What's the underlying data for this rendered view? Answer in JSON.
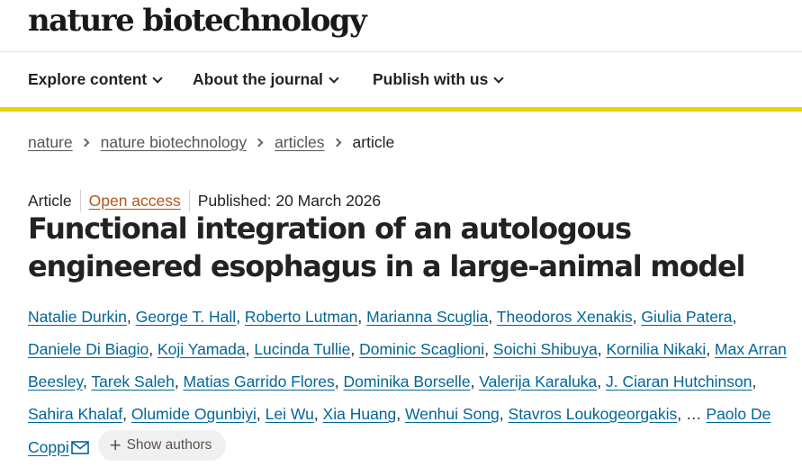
{
  "colors": {
    "accent": "#e6d40a",
    "link": "#006699",
    "open_access": "#b4561f"
  },
  "header": {
    "brand": "nature biotechnology"
  },
  "nav": {
    "items": [
      {
        "label": "Explore content",
        "icon": "chevron-down-icon"
      },
      {
        "label": "About the journal",
        "icon": "chevron-down-icon"
      },
      {
        "label": "Publish with us",
        "icon": "chevron-down-icon"
      }
    ]
  },
  "breadcrumb": {
    "items": [
      "nature",
      "nature biotechnology",
      "articles"
    ],
    "current": "article"
  },
  "article": {
    "type": "Article",
    "access": "Open access",
    "published": "Published: 20 March 2026",
    "title": "Functional integration of an autologous engineered esophagus in a large-animal model",
    "authors": [
      "Natalie Durkin",
      "George T. Hall",
      "Roberto Lutman",
      "Marianna Scuglia",
      "Theodoros Xenakis",
      "Giulia Patera",
      "Daniele Di Biagio",
      "Koji Yamada",
      "Lucinda Tullie",
      "Dominic Scaglioni",
      "Soichi Shibuya",
      "Kornilia Nikaki",
      "Max Arran Beesley",
      "Tarek Saleh",
      "Matias Garrido Flores",
      "Dominika Borselle",
      "Valerija Karaluka",
      "J. Ciaran Hutchinson",
      "Sahira Khalaf",
      "Olumide Ogunbiyi",
      "Lei Wu",
      "Xia Huang",
      "Wenhui Song",
      "Stavros Loukogeorgakis"
    ],
    "ellipsis": "…",
    "corresponding_author": "Paolo De Coppi",
    "show_authors": "Show authors"
  }
}
